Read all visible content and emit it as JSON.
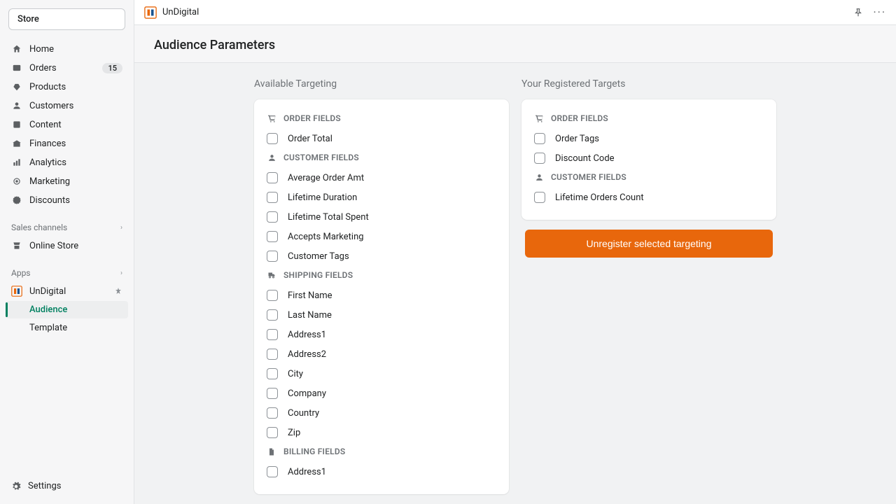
{
  "store_label": "Store",
  "nav": [
    {
      "icon": "home",
      "label": "Home"
    },
    {
      "icon": "orders",
      "label": "Orders",
      "badge": "15"
    },
    {
      "icon": "products",
      "label": "Products"
    },
    {
      "icon": "customers",
      "label": "Customers"
    },
    {
      "icon": "content",
      "label": "Content"
    },
    {
      "icon": "finances",
      "label": "Finances"
    },
    {
      "icon": "analytics",
      "label": "Analytics"
    },
    {
      "icon": "marketing",
      "label": "Marketing"
    },
    {
      "icon": "discounts",
      "label": "Discounts"
    }
  ],
  "sales_channels_label": "Sales channels",
  "sales_channels": [
    {
      "icon": "store",
      "label": "Online Store"
    }
  ],
  "apps_label": "Apps",
  "apps": [
    {
      "label": "UnDigital",
      "subitems": [
        "Audience",
        "Template"
      ],
      "active_sub": 0
    }
  ],
  "settings_label": "Settings",
  "top": {
    "app": "UnDigital"
  },
  "page_title": "Audience Parameters",
  "available": {
    "title": "Available Targeting",
    "groups": [
      {
        "icon": "cart",
        "label": "ORDER FIELDS",
        "items": [
          "Order Total"
        ]
      },
      {
        "icon": "user",
        "label": "CUSTOMER FIELDS",
        "items": [
          "Average Order Amt",
          "Lifetime Duration",
          "Lifetime Total Spent",
          "Accepts Marketing",
          "Customer Tags"
        ]
      },
      {
        "icon": "truck",
        "label": "SHIPPING FIELDS",
        "items": [
          "First Name",
          "Last Name",
          "Address1",
          "Address2",
          "City",
          "Company",
          "Country",
          "Zip"
        ]
      },
      {
        "icon": "file",
        "label": "BILLING FIELDS",
        "items": [
          "Address1"
        ]
      }
    ]
  },
  "registered": {
    "title": "Your Registered Targets",
    "groups": [
      {
        "icon": "cart",
        "label": "ORDER FIELDS",
        "items": [
          "Order Tags",
          "Discount Code"
        ]
      },
      {
        "icon": "user",
        "label": "CUSTOMER FIELDS",
        "items": [
          "Lifetime Orders Count"
        ]
      }
    ],
    "button": "Unregister selected targeting"
  }
}
